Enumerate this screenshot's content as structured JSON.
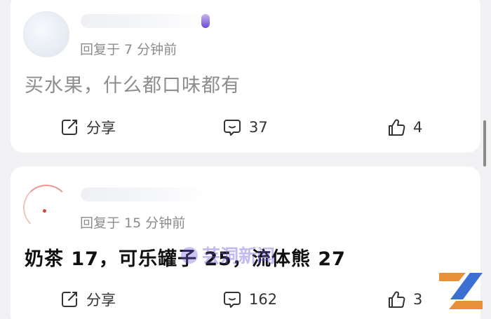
{
  "comments": [
    {
      "meta": "回复于 7 分钟前",
      "text": "买水果，什么都口味都有",
      "share_label": "分享",
      "comment_count": "37",
      "like_count": "4"
    },
    {
      "meta": "回复于 15 分钟前",
      "text": "奶茶 17，可乐罐子 25，流体熊 27",
      "share_label": "分享",
      "comment_count": "162",
      "like_count": "3"
    }
  ],
  "watermark": {
    "text": "芸洞新闻"
  },
  "icons": {
    "share": "share-icon",
    "comment": "comment-bubble-icon",
    "like": "thumbs-up-icon",
    "logo": "brand-logo-icon"
  },
  "colors": {
    "background": "#f1f1f3",
    "card": "#ffffff",
    "meta_text": "#8c8c8c",
    "muted_text": "#8d8d8d",
    "strong_text": "#111111"
  }
}
